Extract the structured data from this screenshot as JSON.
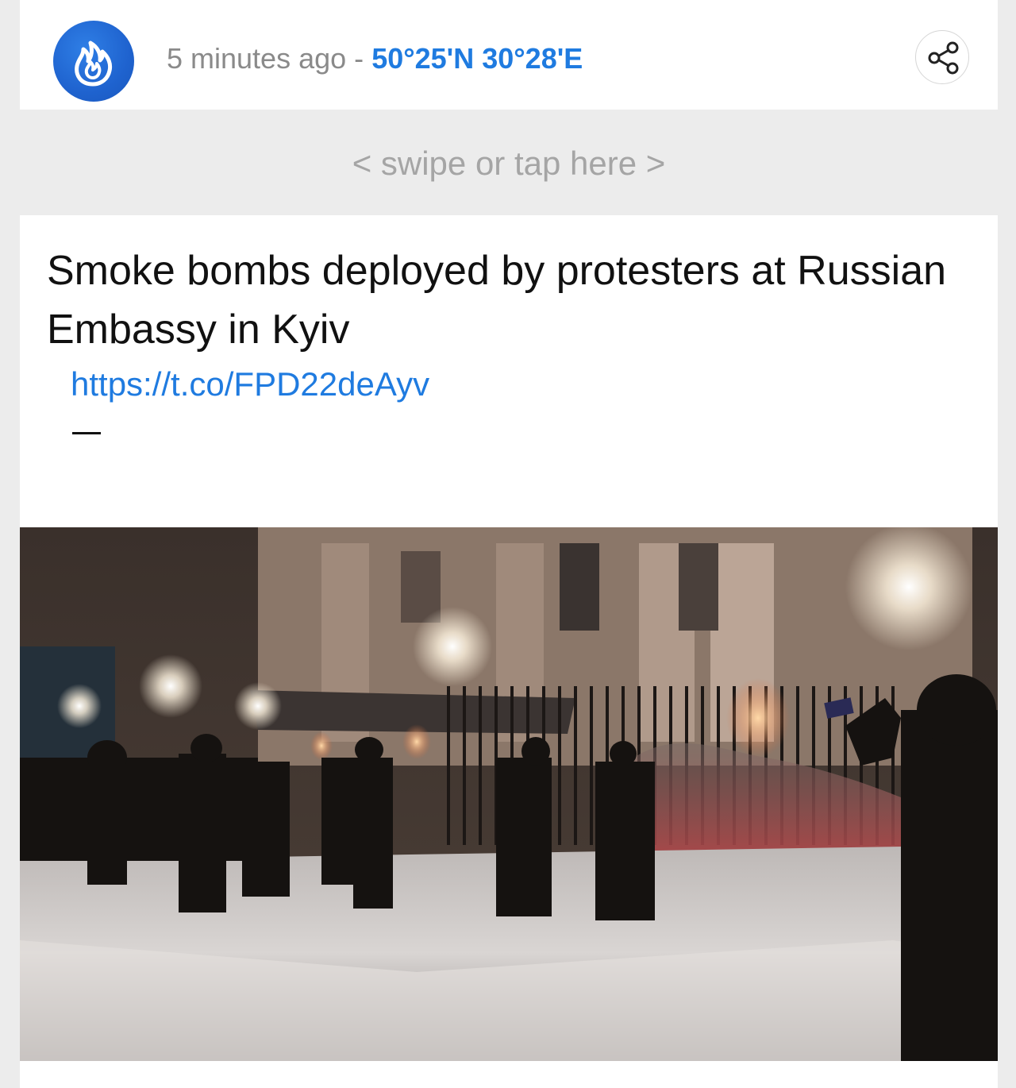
{
  "post": {
    "time_ago": "5 minutes ago",
    "separator": "-",
    "coordinates": "50°25'N 30°28'E",
    "headline": "Smoke bombs deployed by protesters at Russian Embassy in Kyiv",
    "link_text": "https://t.co/FPD22deAyv",
    "dash": "—"
  },
  "navigation": {
    "swipe_hint": "< swipe or tap here >"
  },
  "icons": {
    "logo": "flame-logo-icon",
    "share": "share-icon"
  },
  "colors": {
    "brand_blue": "#1f63cf",
    "link_blue": "#1f7be0",
    "muted_text": "#8a8a8a",
    "swipe_bg": "#ececec"
  },
  "photo": {
    "description_name": "embassy-protest-photo"
  }
}
